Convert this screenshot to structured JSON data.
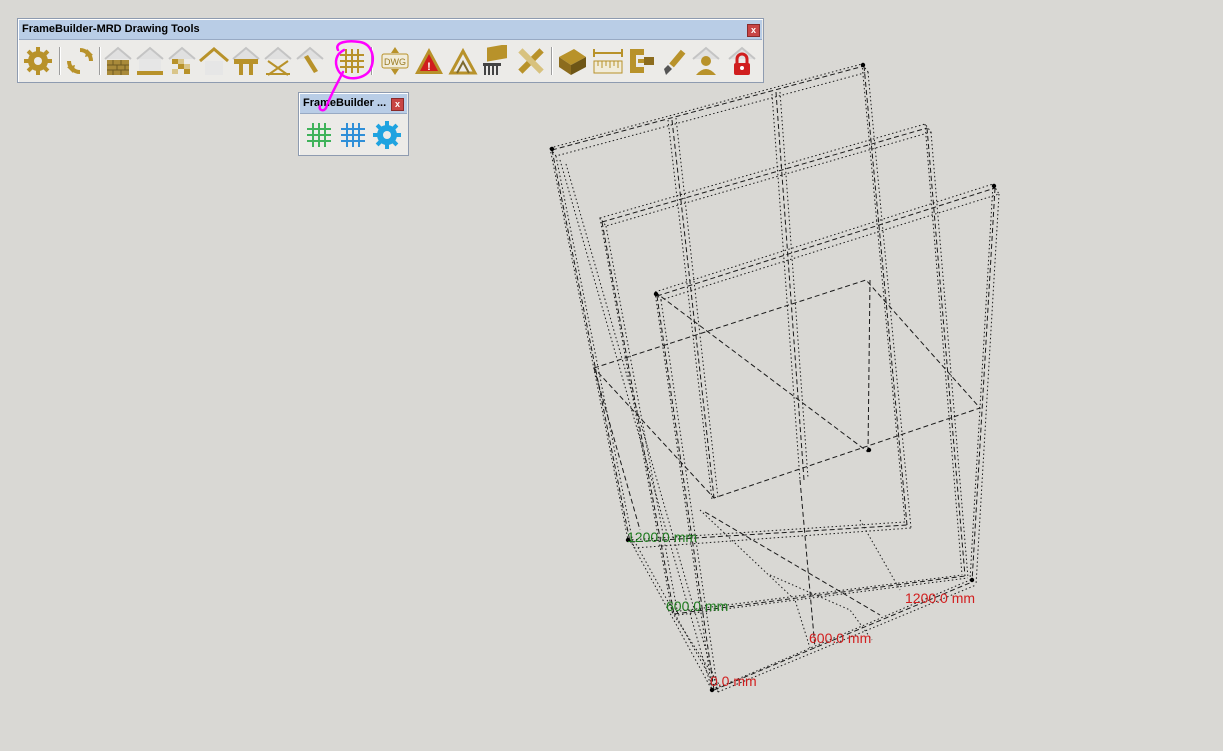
{
  "main_toolbar": {
    "title": "FrameBuilder-MRD Drawing Tools",
    "close": "x",
    "buttons": [
      {
        "icon": "settings-gear-icon"
      },
      {
        "icon": "refresh-icon"
      },
      {
        "icon": "wall-icon"
      },
      {
        "icon": "floor-icon"
      },
      {
        "icon": "roof-tiles-icon"
      },
      {
        "icon": "roof-icon"
      },
      {
        "icon": "gable-icon"
      },
      {
        "icon": "roof-cross-icon"
      },
      {
        "icon": "roof-edit-icon"
      },
      {
        "icon": "grid-icon",
        "highlighted": true
      },
      {
        "icon": "dwg-import-icon",
        "label": "DWG"
      },
      {
        "icon": "warning-icon",
        "label": "!"
      },
      {
        "icon": "truss-icon"
      },
      {
        "icon": "stud-export-icon"
      },
      {
        "icon": "pencil-ruler-icon"
      },
      {
        "icon": "cut-list-icon"
      },
      {
        "icon": "dimension-icon"
      },
      {
        "icon": "clamp-icon"
      },
      {
        "icon": "brush-icon"
      },
      {
        "icon": "user-icon"
      },
      {
        "icon": "lock-icon"
      }
    ]
  },
  "sub_toolbar": {
    "title": "FrameBuilder ...",
    "close": "x",
    "buttons": [
      {
        "icon": "grid-green-icon",
        "color": "#3fb25a"
      },
      {
        "icon": "grid-blue-icon",
        "color": "#2f8fd8"
      },
      {
        "icon": "gear-blue-icon",
        "color": "#1fa3e0"
      }
    ]
  },
  "annotation_color": "#ff00ff",
  "dimensions": {
    "green_1200": "1200.0 mm",
    "green_600": "600.0 mm",
    "red_1200": "1200.0 mm",
    "red_600": "600.0 mm",
    "red_0": "0.0 mm",
    "green_color": "#1e7a1e",
    "red_color": "#d21e1e"
  }
}
